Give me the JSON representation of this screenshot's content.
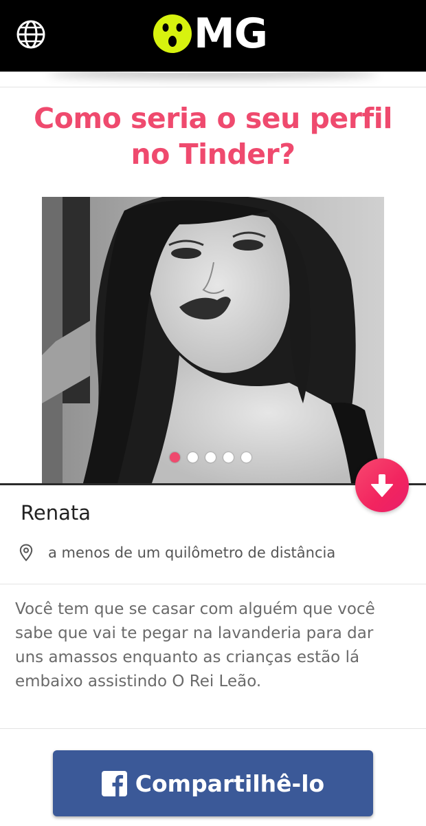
{
  "header": {
    "logo_text": "MG",
    "globe_icon": "globe-icon",
    "logo_icon": "surprised-face-icon",
    "logo_icon_color": "#d7f20f"
  },
  "headline": "Como seria o seu perfil no Tinder?",
  "profile": {
    "photo_count": 5,
    "active_photo_index": 0,
    "name": "Renata",
    "location_icon": "location-pin-icon",
    "distance": "a menos de um quilômetro de distância",
    "bio": "Você tem que se casar com alguém que você sabe que vai te pegar na lavanderia para dar uns amassos enquanto as crianças estão lá embaixo assistindo O Rei Leão."
  },
  "actions": {
    "expand_icon": "arrow-down-icon",
    "share_label": "Compartilhê-lo",
    "share_icon": "facebook-icon"
  },
  "colors": {
    "accent": "#ef4a6e",
    "facebook": "#3b5998",
    "header_bg": "#000000"
  }
}
